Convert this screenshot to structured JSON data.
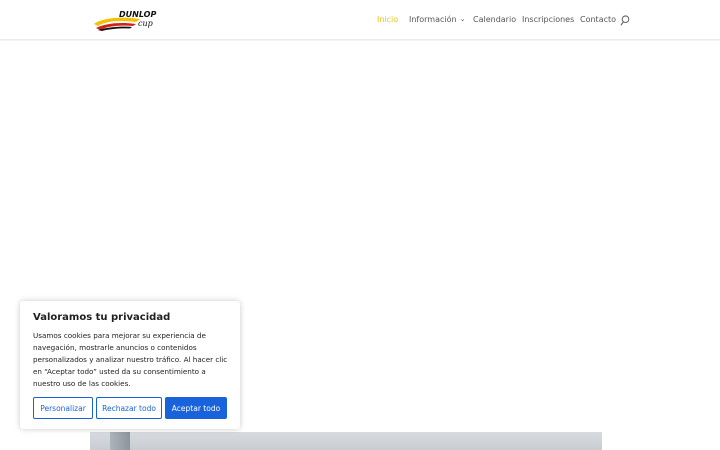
{
  "brand": {
    "logo_text_top": "DUNLOP",
    "logo_text_bottom": "cup",
    "colors": {
      "yellow": "#f2c200",
      "red": "#d32018",
      "black": "#111111"
    }
  },
  "nav": {
    "items": [
      {
        "label": "Inicio",
        "active": true
      },
      {
        "label": "Información",
        "has_dropdown": true
      },
      {
        "label": "Calendario"
      },
      {
        "label": "Inscripciones"
      },
      {
        "label": "Contacto"
      }
    ],
    "dropdown_icon": "chevron-down-icon",
    "search_icon": "search-icon",
    "active_color": "#e9c31a"
  },
  "cookie_banner": {
    "title": "Valoramos tu privacidad",
    "text": "Usamos cookies para mejorar su experiencia de navegación, mostrarle anuncios o contenidos personalizados y analizar nuestro tráfico. Al hacer clic en “Aceptar todo” usted da su consentimiento a nuestro uso de las cookies.",
    "buttons": {
      "customize": "Personalizar",
      "reject": "Rechazar todo",
      "accept": "Aceptar todo"
    },
    "accent_color": "#1863dc"
  }
}
